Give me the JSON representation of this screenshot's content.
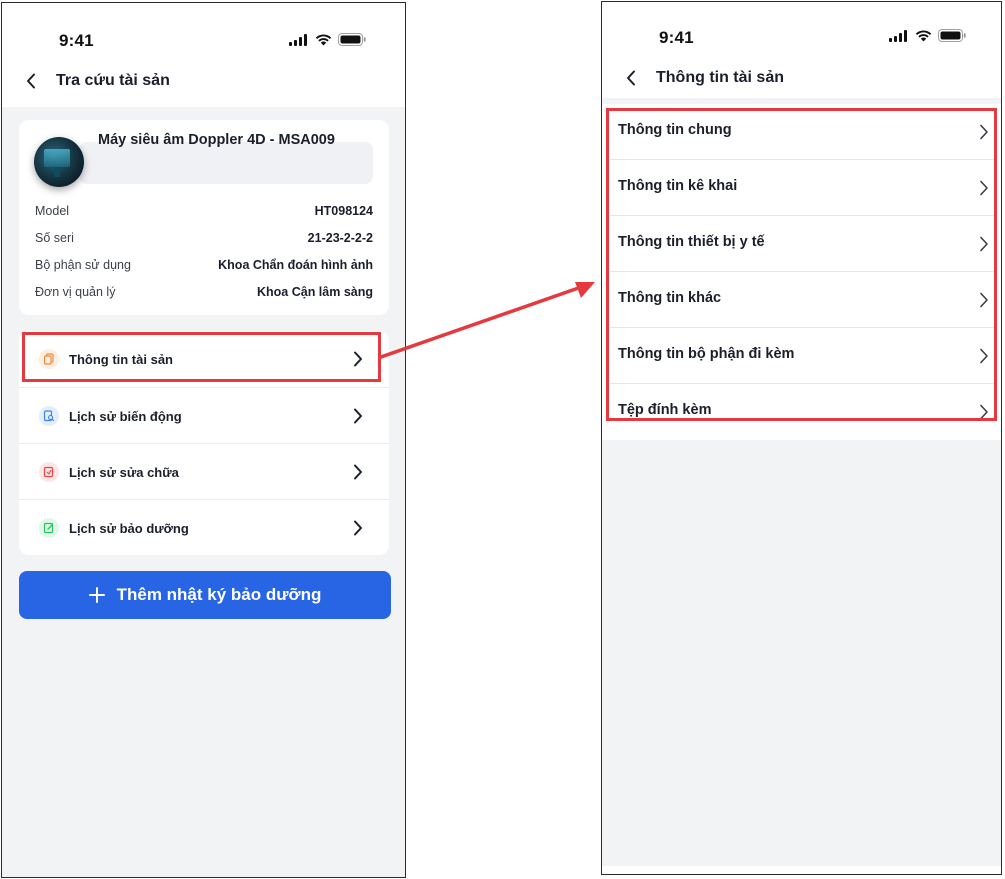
{
  "left_screen": {
    "status": {
      "time": "9:41"
    },
    "nav": {
      "title": "Tra cứu tài sản"
    },
    "asset": {
      "name": "Máy siêu âm Doppler 4D - MSA009",
      "fields": [
        {
          "label": "Model",
          "value": "HT098124"
        },
        {
          "label": "Số seri",
          "value": "21-23-2-2-2"
        },
        {
          "label": "Bộ phận sử dụng",
          "value": "Khoa Chẩn đoán hình ảnh"
        },
        {
          "label": "Đơn vị quản lý",
          "value": "Khoa Cận lâm sàng"
        }
      ]
    },
    "menu": [
      {
        "label": "Thông tin tài sản",
        "icon": "copy-icon",
        "icon_color": "#f08a3c",
        "icon_bg": "#fdeee2"
      },
      {
        "label": "Lịch sử biến động",
        "icon": "document-search-icon",
        "icon_color": "#3b82f6",
        "icon_bg": "#e4eefd"
      },
      {
        "label": "Lịch sử sửa chữa",
        "icon": "repair-doc-icon",
        "icon_color": "#ef4444",
        "icon_bg": "#fde6e6"
      },
      {
        "label": "Lịch sử bảo dưỡng",
        "icon": "edit-doc-icon",
        "icon_color": "#22c55e",
        "icon_bg": "#e2f7ea"
      }
    ],
    "add_button": {
      "label": "Thêm nhật ký bảo dưỡng"
    }
  },
  "right_screen": {
    "status": {
      "time": "9:41"
    },
    "nav": {
      "title": "Thông tin tài sản"
    },
    "items": [
      {
        "label": "Thông tin chung"
      },
      {
        "label": "Thông tin kê khai"
      },
      {
        "label": "Thông tin thiết bị y tế"
      },
      {
        "label": "Thông tin khác"
      },
      {
        "label": "Thông tin bộ phận đi kèm"
      },
      {
        "label": "Tệp đính kèm"
      }
    ]
  },
  "colors": {
    "highlight": "#e5393f",
    "primary_button": "#2765e5",
    "screen_background": "#f2f3f5"
  }
}
